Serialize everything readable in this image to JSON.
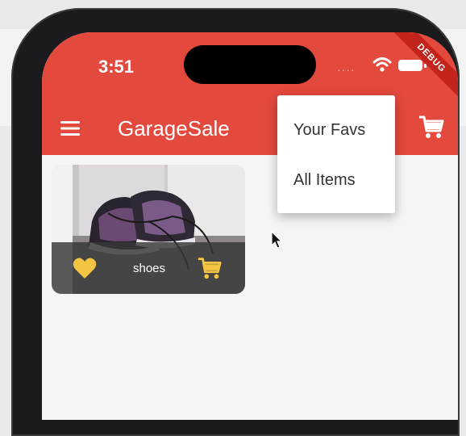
{
  "status_bar": {
    "time": "3:51",
    "debug_label": "DEBUG",
    "signal_dots": "····",
    "colors": {
      "bar": "#e4493d",
      "debug_ribbon": "#c2231a"
    }
  },
  "app_bar": {
    "title": "GarageSale",
    "menu_icon": "hamburger-menu-icon",
    "cart_icon": "shopping-cart-icon",
    "color": "#e4493d"
  },
  "products": [
    {
      "name": "shoes",
      "favorite_icon": "heart-icon",
      "cart_icon": "shopping-cart-icon",
      "accent": "#f4c542"
    }
  ],
  "filter_menu": {
    "items": [
      {
        "label": "Your Favs"
      },
      {
        "label": "All Items"
      }
    ]
  }
}
